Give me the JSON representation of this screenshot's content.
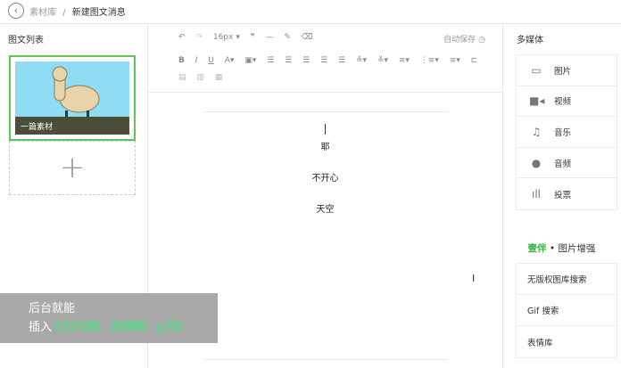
{
  "header": {
    "crumb_root": "素材库",
    "separator": "/",
    "crumb_current": "新建图文消息"
  },
  "left": {
    "title": "图文列表",
    "card_caption": "一篇素材",
    "add_symbol": "+"
  },
  "toolbar": {
    "font_size": "16px",
    "autosave": "自动保存"
  },
  "editor": {
    "lines": [
      "耶",
      "不开心",
      "天空"
    ]
  },
  "right": {
    "media_title": "多媒体",
    "media_items": [
      {
        "label": "图片",
        "icon": "image-icon"
      },
      {
        "label": "视频",
        "icon": "video-icon"
      },
      {
        "label": "音乐",
        "icon": "music-icon"
      },
      {
        "label": "音频",
        "icon": "microphone-icon"
      },
      {
        "label": "投票",
        "icon": "poll-icon"
      }
    ],
    "brand": "壹伴",
    "brand_sep": "•",
    "brand_suffix": "图片增强",
    "brand_color": "#3cb54a",
    "tools": [
      "无版权图库搜索",
      "Gif 搜索",
      "表情库"
    ]
  },
  "banner": {
    "line1": "后台就能",
    "line2_prefix": "插入",
    "line2_highlight": "无版权图、表情图、gif图"
  }
}
